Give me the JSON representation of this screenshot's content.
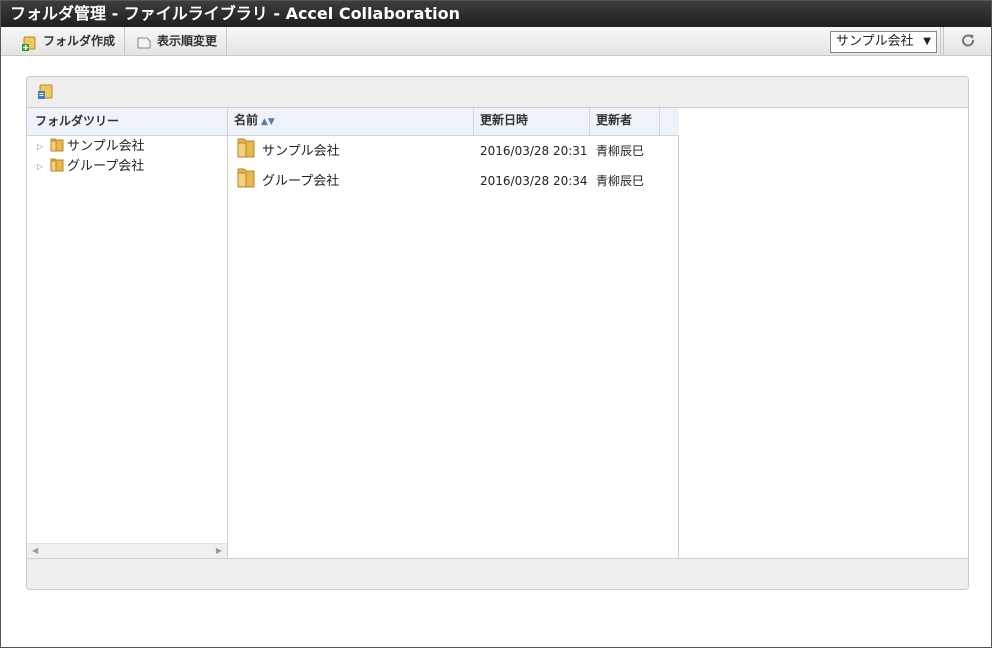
{
  "window": {
    "title": "フォルダ管理 - ファイルライブラリ - Accel Collaboration"
  },
  "toolbar": {
    "create_folder_label": "フォルダ作成",
    "reorder_label": "表示順変更",
    "company_selected": "サンプル会社",
    "refresh_icon": "refresh-icon"
  },
  "tree": {
    "header": "フォルダツリー",
    "items": [
      {
        "label": "サンプル会社"
      },
      {
        "label": "グループ会社"
      }
    ]
  },
  "list": {
    "columns": {
      "name": "名前",
      "date": "更新日時",
      "user": "更新者"
    },
    "rows": [
      {
        "name": "サンプル会社",
        "date": "2016/03/28 20:31",
        "user": "青柳辰巳"
      },
      {
        "name": "グループ会社",
        "date": "2016/03/28 20:34",
        "user": "青柳辰巳"
      }
    ]
  },
  "colors": {
    "titlebar": "#2a2a2a",
    "header_bg": "#eef3fa",
    "folder": "#e8b84a"
  }
}
